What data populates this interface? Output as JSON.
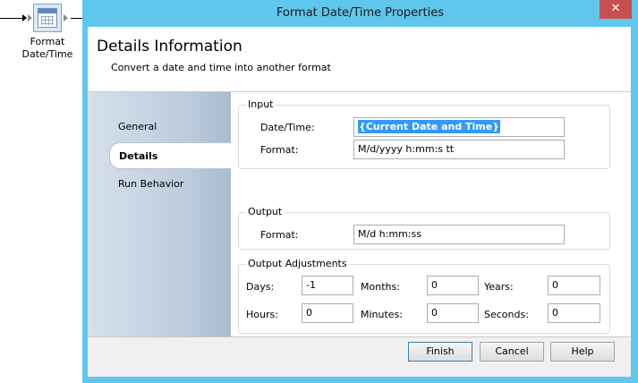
{
  "workflow_node": {
    "label_line1": "Format",
    "label_line2": "Date/Time",
    "icon": "calendar-icon"
  },
  "dialog": {
    "title": "Format Date/Time Properties",
    "close_symbol": "✕"
  },
  "header": {
    "title": "Details Information",
    "subtitle": "Convert a date and time into another format"
  },
  "nav": {
    "items": [
      {
        "label": "General"
      },
      {
        "label": "Details"
      },
      {
        "label": "Run Behavior"
      }
    ],
    "selected": "Details"
  },
  "input_group": {
    "title": "Input",
    "date_time_label": "Date/Time:",
    "date_time_value": "{Current Date and Time}",
    "format_label": "Format:",
    "format_value": "M/d/yyyy h:mm:s tt"
  },
  "output_group": {
    "title": "Output",
    "format_label": "Format:",
    "format_value": "M/d h:mm:ss"
  },
  "adjustments_group": {
    "title": "Output Adjustments",
    "days_label": "Days:",
    "days_value": "-1",
    "months_label": "Months:",
    "months_value": "0",
    "years_label": "Years:",
    "years_value": "0",
    "hours_label": "Hours:",
    "hours_value": "0",
    "minutes_label": "Minutes:",
    "minutes_value": "0",
    "seconds_label": "Seconds:",
    "seconds_value": "0"
  },
  "footer": {
    "finish_label": "Finish",
    "cancel_label": "Cancel",
    "help_label": "Help"
  },
  "colors": {
    "title_bar": "#5fc6ee",
    "close_button": "#c7504e",
    "selection": "#3399ff"
  }
}
